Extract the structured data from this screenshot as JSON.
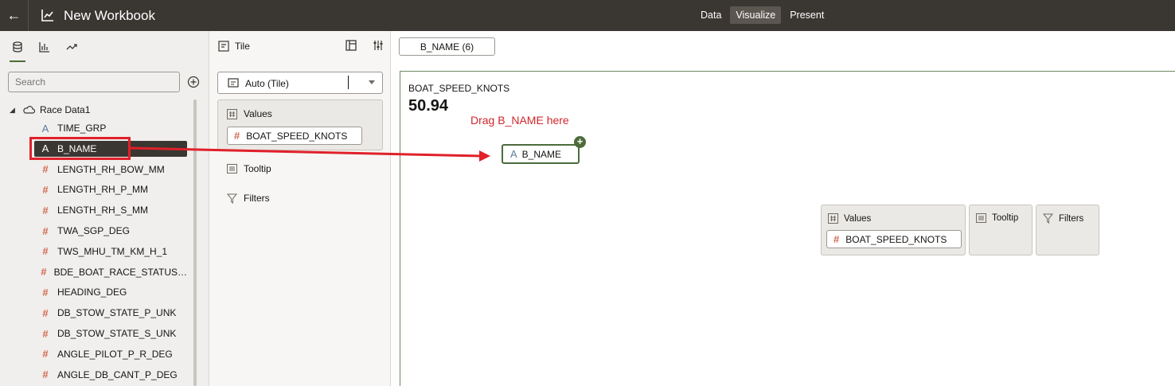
{
  "header": {
    "title": "New Workbook",
    "modes": [
      "Data",
      "Visualize",
      "Present"
    ],
    "active_mode": "Visualize"
  },
  "data_panel": {
    "search_placeholder": "Search",
    "dataset": "Race Data1",
    "fields": [
      {
        "name": "TIME_GRP",
        "type": "attribute"
      },
      {
        "name": "B_NAME",
        "type": "attribute",
        "selected": true
      },
      {
        "name": "LENGTH_RH_BOW_MM",
        "type": "measure"
      },
      {
        "name": "LENGTH_RH_P_MM",
        "type": "measure"
      },
      {
        "name": "LENGTH_RH_S_MM",
        "type": "measure"
      },
      {
        "name": "TWA_SGP_DEG",
        "type": "measure"
      },
      {
        "name": "TWS_MHU_TM_KM_H_1",
        "type": "measure"
      },
      {
        "name": "BDE_BOAT_RACE_STATUS…",
        "type": "measure"
      },
      {
        "name": "HEADING_DEG",
        "type": "measure"
      },
      {
        "name": "DB_STOW_STATE_P_UNK",
        "type": "measure"
      },
      {
        "name": "DB_STOW_STATE_S_UNK",
        "type": "measure"
      },
      {
        "name": "ANGLE_PILOT_P_R_DEG",
        "type": "measure"
      },
      {
        "name": "ANGLE_DB_CANT_P_DEG",
        "type": "measure"
      }
    ]
  },
  "grammar_panel": {
    "viz_type": "Tile",
    "viz_selector": "Auto (Tile)",
    "values_label": "Values",
    "values_field": "BOAT_SPEED_KNOTS",
    "tooltip_label": "Tooltip",
    "filters_label": "Filters"
  },
  "canvas": {
    "filter_pill": "B_NAME (6)",
    "measure_label": "BOAT_SPEED_KNOTS",
    "measure_value": "50.94",
    "annotation": "Drag B_NAME here",
    "drop_pill": "B_NAME",
    "mini_values_label": "Values",
    "mini_values_field": "BOAT_SPEED_KNOTS",
    "mini_tooltip_label": "Tooltip",
    "mini_filters_label": "Filters"
  },
  "colors": {
    "topbar": "#3a3632",
    "accent": "#4d6b3c",
    "measure_icon": "#d06a51",
    "attribute_icon": "#5f7d9c",
    "annotation": "#e0202a"
  }
}
